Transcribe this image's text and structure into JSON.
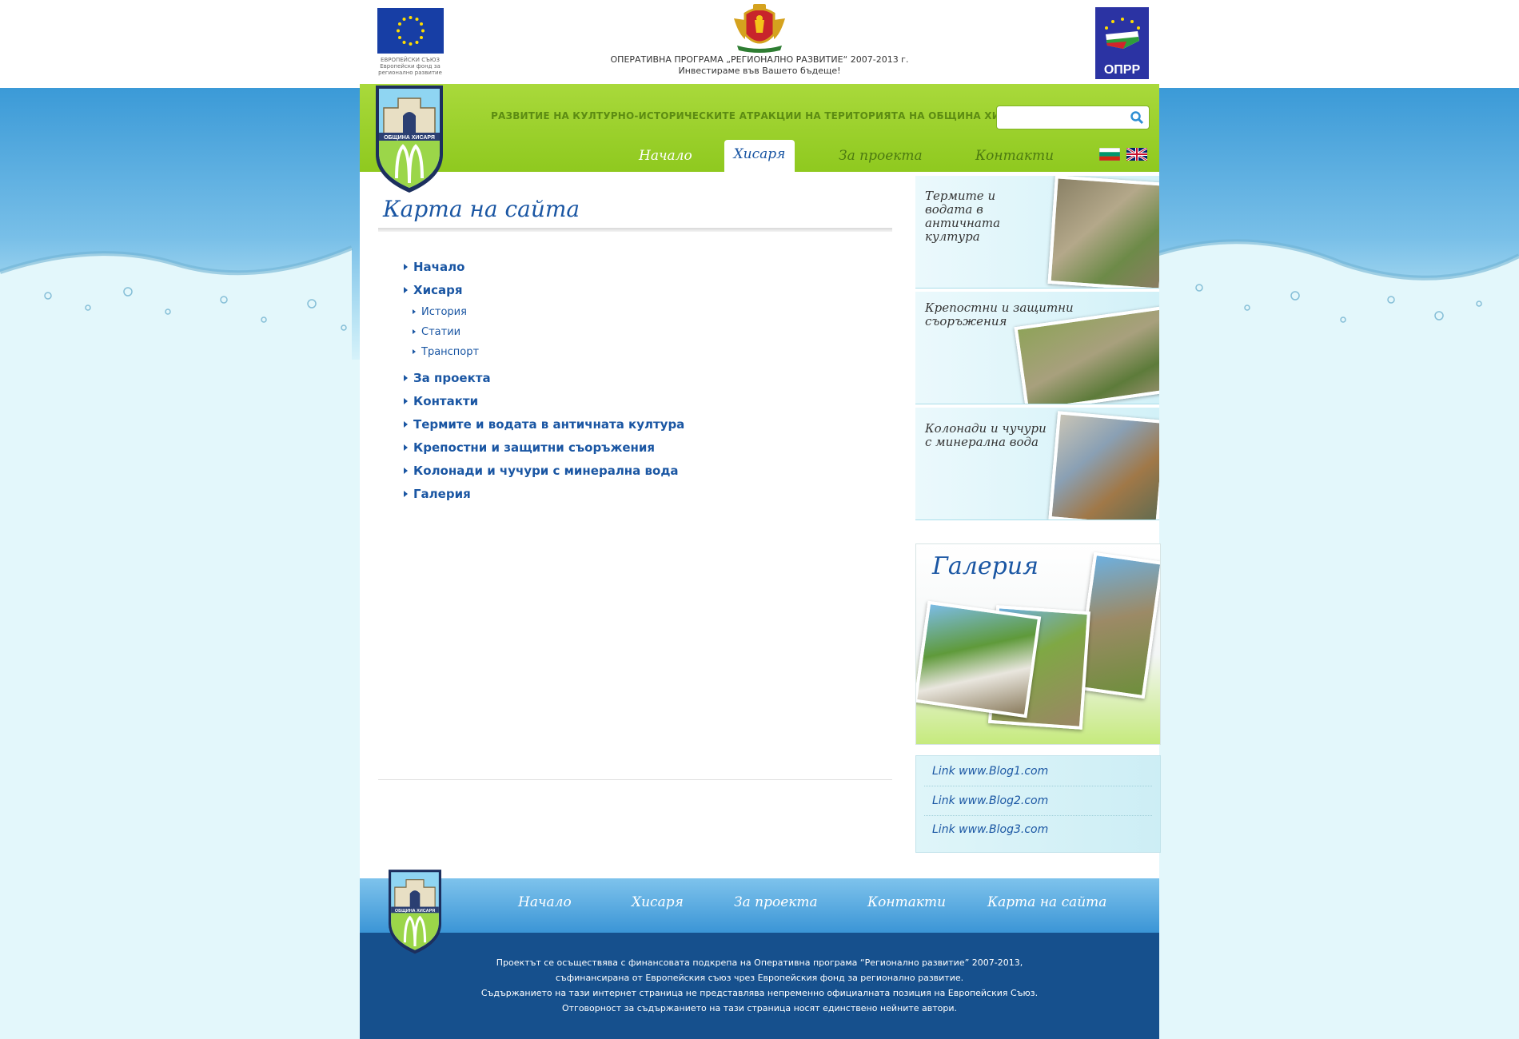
{
  "top": {
    "eu_caption": [
      "ЕВРОПЕЙСКИ СЪЮЗ",
      "Европейски фонд за",
      "регионално развитие"
    ],
    "program_title": "ОПЕРАТИВНА ПРОГРАМА „РЕГИОНАЛНО РАЗВИТИЕ“ 2007-2013 г.",
    "program_slogan": "Инвестираме във Вашето бъдеще!",
    "oprr_label": "ОПРР"
  },
  "header": {
    "tagline": "РАЗВИТИЕ НА КУЛТУРНО-ИСТОРИЧЕСКИТЕ АТРАКЦИИ НА ТЕРИТОРИЯТА НА ОБЩИНА ХИСАРЯ",
    "logo_text": "ОБЩИНА ХИСАРЯ",
    "search": {
      "placeholder": "",
      "value": ""
    },
    "nav": [
      "Начало",
      "Хисаря",
      "За проекта",
      "Контакти"
    ],
    "active_nav": "Хисаря"
  },
  "main": {
    "title": "Карта на сайта",
    "sitemap": {
      "home": "Начало",
      "hisarya": "Хисаря",
      "sub": [
        "История",
        "Статии",
        "Транспорт"
      ],
      "rest": [
        "За проекта",
        "Контакти",
        "Термите и водата в античната култура",
        "Крепостни и защитни съоръжения",
        "Колонади и чучури с минерална вода",
        "Галерия"
      ]
    }
  },
  "sidebar": {
    "promos": [
      "Термите и водата в античната култура",
      "Крепостни и защитни съоръжения",
      "Колонади и чучури с минерална вода"
    ],
    "gallery_title": "Галерия",
    "links": [
      "Link www.Blog1.com",
      "Link www.Blog2.com",
      "Link www.Blog3.com"
    ]
  },
  "footer": {
    "nav": [
      "Начало",
      "Хисаря",
      "За проекта",
      "Контакти",
      "Карта на сайта"
    ],
    "lines": [
      "Проектът се осъществява с финансовата подкрепа на Оперативна програма “Регионално развитие” 2007-2013,",
      "съфинансирана от Европейския съюз чрез Европейския фонд за регионално развитие.",
      "Съдържанието на тази интернет страница не представлява непременно официалната позиция на Европейския Съюз.",
      "Отговорност за съдържанието на тази страница носят единствено нейните автори."
    ]
  },
  "colors": {
    "green": "#9acf2a",
    "blue": "#1a56a3",
    "footer_blue": "#16508d",
    "sky": "#3b9ad7"
  }
}
